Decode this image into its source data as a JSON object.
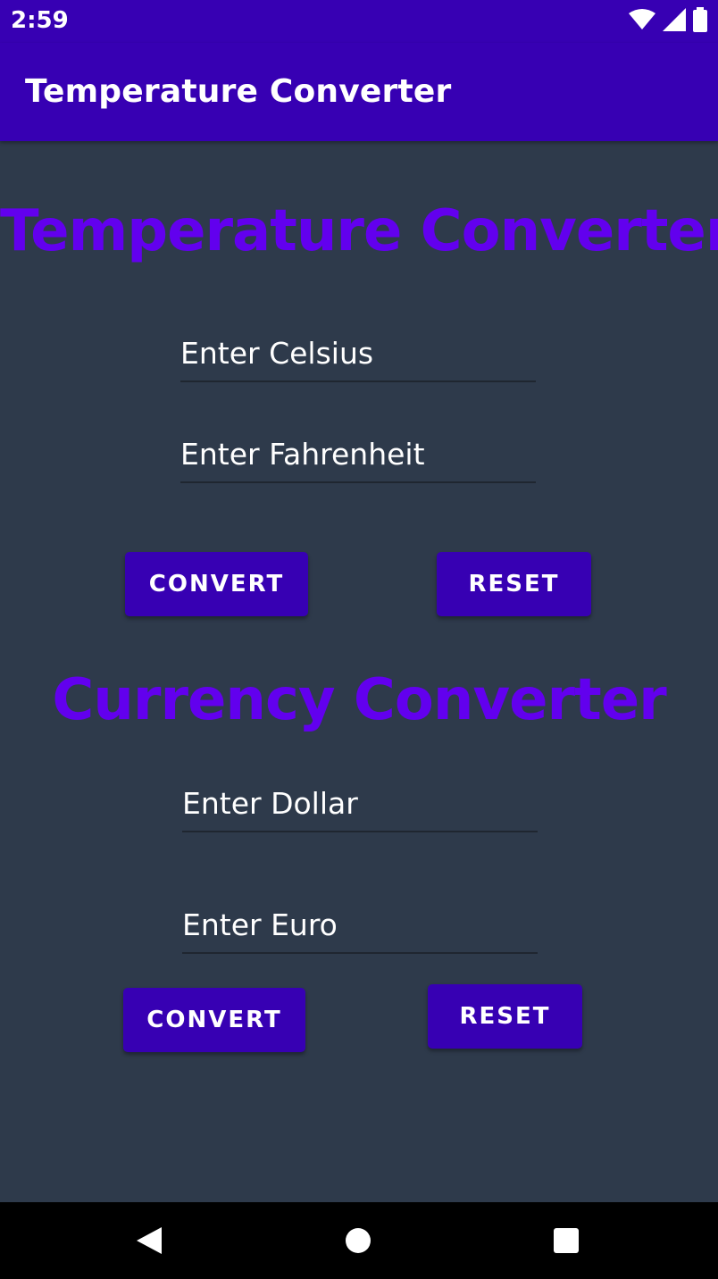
{
  "status_bar": {
    "time": "2:59",
    "icons": [
      "wifi-icon",
      "signal-icon",
      "battery-icon"
    ]
  },
  "app_bar": {
    "title": "Temperature Converter"
  },
  "temperature_section": {
    "heading": "Temperature Converter",
    "celsius_placeholder": "Enter Celsius",
    "celsius_value": "",
    "fahrenheit_placeholder": "Enter Fahrenheit",
    "fahrenheit_value": "",
    "convert_label": "CONVERT",
    "reset_label": "RESET"
  },
  "currency_section": {
    "heading": "Currency Converter",
    "dollar_placeholder": "Enter Dollar",
    "dollar_value": "",
    "euro_placeholder": "Enter Euro",
    "euro_value": "",
    "convert_label": "CONVERT",
    "reset_label": "RESET"
  },
  "nav_bar": {
    "icons": [
      "back-icon",
      "home-icon",
      "recents-icon"
    ]
  },
  "colors": {
    "primary": "#3700b3",
    "heading": "#6200ee",
    "background": "#2e3a4b",
    "text": "#ffffff"
  }
}
